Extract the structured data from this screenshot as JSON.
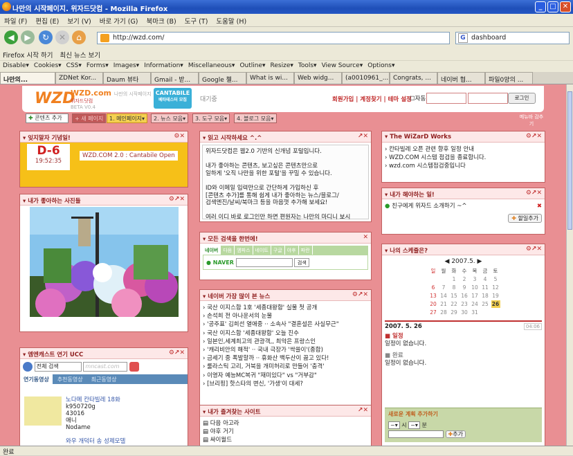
{
  "window": {
    "title": "나만의 시작페이지. 위자드닷컴 - Mozilla Firefox"
  },
  "menu": [
    "파일 (F)",
    "편집 (E)",
    "보기 (V)",
    "바로 가기 (G)",
    "북마크 (B)",
    "도구 (T)",
    "도움말 (H)"
  ],
  "nav": {
    "url": "http://wzd.com/",
    "search": "dashboard"
  },
  "bookmarks": [
    "Firefox 시작 하기",
    "최신 뉴스 보기"
  ],
  "devtoolbar": [
    "Disable▾",
    "Cookies▾",
    "CSS▾",
    "Forms▾",
    "Images▾",
    "Information▾",
    "Miscellaneous▾",
    "Outline▾",
    "Resize▾",
    "Tools▾",
    "View Source▾",
    "Options▾"
  ],
  "tabs": [
    "나만의...",
    "ZDNet Kor...",
    "Daum 뷰타",
    "Gmail - 받...",
    "Google 첼...",
    "What is wi...",
    "Web widg...",
    "(a0010961_...",
    "Congrats, ...",
    "네이버 협...",
    "파일0양의 ..."
  ],
  "site": {
    "logo": "WZD",
    "logo_name": "WZD.com",
    "logo_sub": "나만의 시작페이지",
    "logo_sub2": "위자드닷컴",
    "logo_beta": "BETA V0.4",
    "cantabile": "CANTABILE",
    "cantabile_sub": "베타테스터 모집",
    "daegi": "대기중",
    "links": "회원가입 | 계정찾기 | 테마 설정",
    "autologin": "자동로그인",
    "login": "로그인"
  },
  "navtabs": {
    "add": "콘텐츠 추가",
    "new": "+ 새 페이지",
    "t1": "1. 메인페이지▾",
    "t2": "2. 뉴스 모음▾",
    "t3": "3. 도구 모음▾",
    "t4": "4. 블로그 모음▾",
    "hide": "메뉴바 감추기"
  },
  "anniv": {
    "title": "잊지말자 기념일!",
    "dday": "D-6",
    "time": "19:52:35",
    "event": "WZD.COM 2.0 : Cantabile Open"
  },
  "photo": {
    "title": "내가 좋아하는 사진들"
  },
  "ucc": {
    "title": "엠엔캐스트 연기 UCC",
    "select": "전체 검색",
    "placeholder": "mncast.com",
    "tabs": [
      "연기동영상",
      "추천동영상",
      "최근동영상"
    ],
    "v1_title": "노다메 칸타빌레 18화",
    "v1_user": "k950720g",
    "v1_views": "43016",
    "v1_tag": "애니",
    "v1_cat": "Nodame",
    "v2_title": "와우 개덕터 송 성제모델"
  },
  "read": {
    "title": "읽고 시작하세요 ^.^",
    "lines": [
      "위자드닷컴은 웹2.0 기반의 신개념 포털입니다.",
      "",
      "내가 좋아하는 콘텐츠, 보고싶은 콘텐츠만으로",
      "일하게 '오직 나만을 위한 포털'을 꾸밀 수 있습니다.",
      "",
      "ID와 이메일 입력만으로 간단하게 가입하신 후",
      "[콘텐츠 추가]를 통해 쉽게 내가 좋아하는 뉴스/블로그/",
      "검색엔진/날씨/북마크 등을 마음껏 추가해 보세요!",
      "",
      "여러 이디 바로 로그인만 하면 편원자는 나만의 마디니 보시"
    ]
  },
  "search": {
    "title": "모든 검색을 한번에!",
    "tabs": [
      "네이버",
      "다음",
      "엠파스",
      "네이트",
      "구글",
      "야후",
      "파란"
    ],
    "brand": "NAVER",
    "btn": "검색"
  },
  "news": {
    "title": "네이버 가장 많이 본 뉴스",
    "items": [
      "국산 이지스함 1호 '세종대왕함' 실물 첫 공개",
      "손석희 전 아나운서의 눈물",
      "'공주표' 김희선 열애중 ·· 소속사 \"결혼설은 사실무근\"",
      "국산 이지스함 '세종대왕함' 오늘 진수",
      "일본인,세계최고의 관광객,, 최악은 프랑스인",
      "'캐리비안의 해적' ·· 국내 극장가 '싹쓸이'(종합)",
      "금세기 중 폭발할까 ·· 휴화산 백두산이 끓고 있다!",
      "룰라스틱 고리, 거북을 개미허리로 만들어 '충격'",
      "이영자 예능MC복귀 \"재미있다\" vs \"거부감\"",
      "[브리핑] 핫스타의 변신, '가생'이 대세?"
    ]
  },
  "fav": {
    "title": "내가 즐겨찾는 사이트",
    "items": [
      "다음 아고라",
      "야후 거기",
      "싸이월드"
    ]
  },
  "wizard": {
    "title": "The WiZarD Works",
    "items": [
      "칸타빌레 오픈 관련 향후 일정 안내",
      "WZD.COM 시스템 점검을 종료합니다.",
      "wzd.com 시스템점검중입니다"
    ]
  },
  "todo": {
    "title": "내가 해야하는 일!",
    "item": "친구에게 위자드 소개하기 ~^",
    "btn": "할일추가"
  },
  "schedule": {
    "title": "나의 스케쥴은?",
    "month": "2007.5.",
    "days": [
      "일",
      "월",
      "화",
      "수",
      "목",
      "금",
      "토"
    ],
    "cells": [
      "",
      "",
      "1",
      "2",
      "3",
      "4",
      "5",
      "6",
      "7",
      "8",
      "9",
      "10",
      "11",
      "12",
      "13",
      "14",
      "15",
      "16",
      "17",
      "18",
      "19",
      "20",
      "21",
      "22",
      "23",
      "24",
      "25",
      "26",
      "27",
      "28",
      "29",
      "30",
      "31",
      "",
      ""
    ],
    "date": "2007. 5. 26",
    "time": "04:06",
    "sec1": "일정",
    "empty1": "일정이 없습니다.",
    "sec2": "완료",
    "empty2": "일정이 없습니다.",
    "addtitle": "새로운 계획 추가하기",
    "hour": "시",
    "min": "분",
    "addbtn": "추가"
  },
  "status": "완료"
}
